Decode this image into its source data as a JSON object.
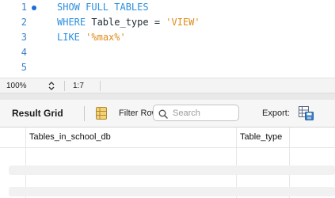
{
  "editor": {
    "line_numbers": [
      "1",
      "2",
      "3",
      "4",
      "5"
    ],
    "lines": [
      {
        "kw": "SHOW FULL TABLES"
      },
      {
        "kw": "WHERE",
        "text": " Table_type = ",
        "str": "'VIEW'"
      },
      {
        "kw": "LIKE",
        "text": " ",
        "str": "'%max%'"
      }
    ]
  },
  "status": {
    "zoom": "100%",
    "cursor": "1:7"
  },
  "toolbar": {
    "result_grid_label": "Result Grid",
    "filter_label": "Filter Rows:",
    "search_placeholder": "Search",
    "export_label": "Export:"
  },
  "grid": {
    "columns": [
      "Tables_in_school_db",
      "Table_type"
    ]
  },
  "colors": {
    "keyword": "#2b8fe0",
    "string": "#e08a1a",
    "line_number": "#3b80c8"
  }
}
